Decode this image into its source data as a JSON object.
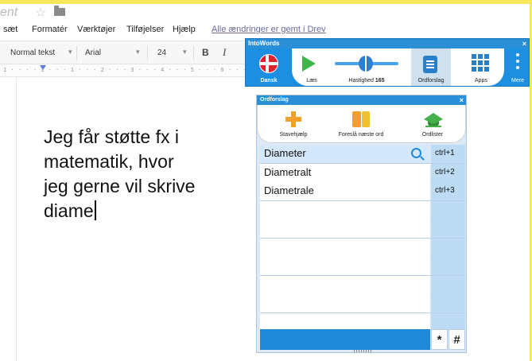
{
  "colors": {
    "highlight_border": "#f5e85a",
    "intowords_blue": "#1d8fe0",
    "doc_text": "#111111"
  },
  "doc": {
    "title_fragment": "ent",
    "menus": [
      "sæt",
      "Formatér",
      "Værktøjer",
      "Tilføjelser",
      "Hjælp"
    ],
    "save_status": "Alle ændringer er gemt i Drev",
    "toolbar": {
      "style": "Normal tekst",
      "font": "Arial",
      "size": "24",
      "bold": "B",
      "italic": "I"
    },
    "ruler": "1 · · · · 1 · · · 1 · · · 2 · · · 3 · · · 4 · · · 5 · · · 6 · · · 7 · · · 8",
    "body_lines": [
      "Jeg får støtte fx i",
      "matematik, hvor",
      "jeg gerne vil skrive",
      "diame"
    ]
  },
  "intowords": {
    "title": "IntoWords",
    "close": "×",
    "buttons": {
      "language": "Dansk",
      "read": "Læs",
      "speed_label": "Hastighed",
      "speed_value": "165",
      "suggestions": "Ordforslag",
      "apps": "Apps",
      "more": "Mere"
    }
  },
  "ordforslag": {
    "title": "Ordforslag",
    "close": "×",
    "tools": [
      "Stavehjælp",
      "Foreslå næste ord",
      "Ordlister"
    ],
    "rows": [
      {
        "word": "Diameter",
        "key": "ctrl+1"
      },
      {
        "word": "Diametralt",
        "key": "ctrl+2"
      },
      {
        "word": "Diametrale",
        "key": "ctrl+3"
      },
      {
        "word": "",
        "key": ""
      },
      {
        "word": "",
        "key": ""
      },
      {
        "word": "",
        "key": ""
      },
      {
        "word": "",
        "key": ""
      },
      {
        "word": "",
        "key": ""
      },
      {
        "word": "",
        "key": ""
      },
      {
        "word": "",
        "key": ""
      }
    ],
    "bottom_keys": [
      "*",
      "#"
    ]
  }
}
